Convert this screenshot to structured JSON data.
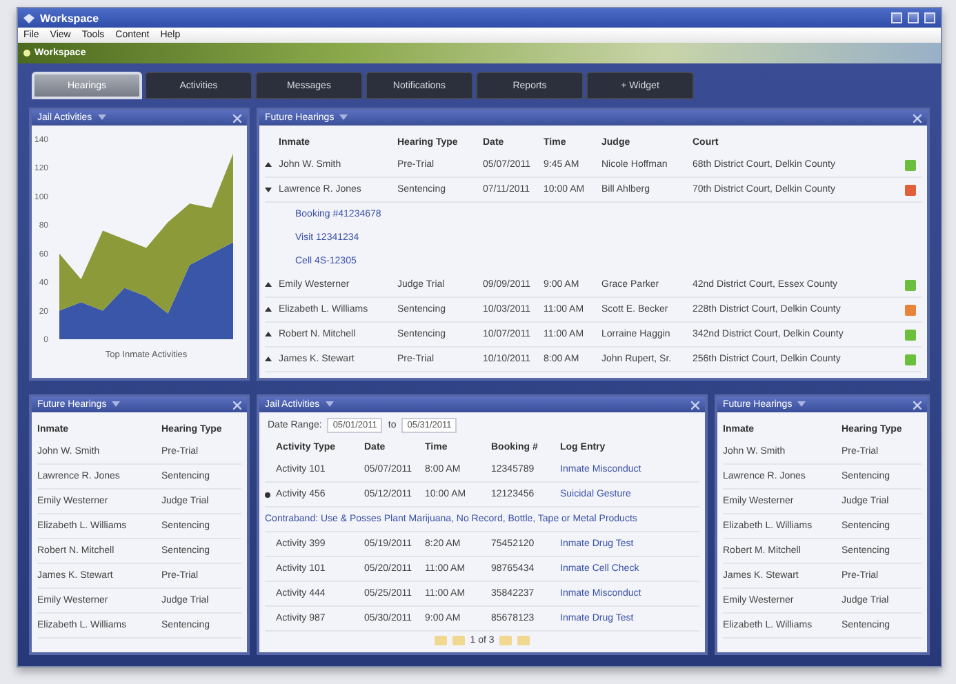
{
  "window": {
    "title": "Workspace"
  },
  "menu": [
    "File",
    "View",
    "Tools",
    "Content",
    "Help"
  ],
  "workspace_label": "Workspace",
  "tabs": [
    {
      "label": "Hearings",
      "selected": true
    },
    {
      "label": "Activities",
      "selected": false
    },
    {
      "label": "Messages",
      "selected": false
    },
    {
      "label": "Notifications",
      "selected": false
    },
    {
      "label": "Reports",
      "selected": false
    },
    {
      "label": "+ Widget",
      "selected": false
    }
  ],
  "jail_chart": {
    "title": "Jail Activities",
    "chart_data": {
      "type": "area",
      "stacked": true,
      "xlabel": "Top Inmate Activities",
      "ylim": [
        0,
        140
      ],
      "yticks": [
        0,
        20,
        40,
        60,
        80,
        100,
        120,
        140
      ],
      "series": [
        {
          "color": "#3a56a8",
          "values": [
            20,
            26,
            20,
            36,
            30,
            18,
            52,
            60,
            68
          ]
        },
        {
          "color": "#8c9a3a",
          "values": [
            40,
            16,
            56,
            34,
            34,
            64,
            43,
            32,
            62
          ]
        }
      ]
    }
  },
  "future_hearings": {
    "title": "Future Hearings",
    "columns": [
      "Inmate",
      "Hearing Type",
      "Date",
      "Time",
      "Judge",
      "Court"
    ],
    "rows": [
      {
        "cells": [
          "John W. Smith",
          "Pre-Trial",
          "05/07/2011",
          "9:45 AM",
          "Nicole Hoffman",
          "68th District Court, Delkin County"
        ],
        "expanded": false,
        "color": "#6cbf3c"
      },
      {
        "cells": [
          "Lawrence R. Jones",
          "Sentencing",
          "07/11/2011",
          "10:00 AM",
          "Bill Ahlberg",
          "70th District Court, Delkin County"
        ],
        "expanded": true,
        "color": "#e0603a",
        "details": [
          "Booking #41234678",
          "Visit 12341234",
          "Cell 4S-12305"
        ]
      },
      {
        "cells": [
          "Emily Westerner",
          "Judge Trial",
          "09/09/2011",
          "9:00 AM",
          "Grace Parker",
          "42nd District Court, Essex County"
        ],
        "expanded": false,
        "color": "#6cbf3c"
      },
      {
        "cells": [
          "Elizabeth L. Williams",
          "Sentencing",
          "10/03/2011",
          "11:00 AM",
          "Scott E. Becker",
          "228th District Court, Delkin County"
        ],
        "expanded": false,
        "color": "#e8843a"
      },
      {
        "cells": [
          "Robert N. Mitchell",
          "Sentencing",
          "10/07/2011",
          "11:00 AM",
          "Lorraine Haggin",
          "342nd District Court, Delkin County"
        ],
        "expanded": false,
        "color": "#6cbf3c"
      },
      {
        "cells": [
          "James K. Stewart",
          "Pre-Trial",
          "10/10/2011",
          "8:00 AM",
          "John Rupert, Sr.",
          "256th District Court, Delkin County"
        ],
        "expanded": false,
        "color": "#6cbf3c"
      }
    ]
  },
  "future_hearings_left": {
    "title": "Future Hearings",
    "columns": [
      "Inmate",
      "Hearing Type"
    ],
    "rows": [
      [
        "John W. Smith",
        "Pre-Trial"
      ],
      [
        "Lawrence R. Jones",
        "Sentencing"
      ],
      [
        "Emily Westerner",
        "Judge Trial"
      ],
      [
        "Elizabeth L. Williams",
        "Sentencing"
      ],
      [
        "Robert N. Mitchell",
        "Sentencing"
      ],
      [
        "James K. Stewart",
        "Pre-Trial"
      ],
      [
        "Emily Westerner",
        "Judge Trial"
      ],
      [
        "Elizabeth L. Williams",
        "Sentencing"
      ]
    ]
  },
  "jail_activities": {
    "title": "Jail Activities",
    "date_range": {
      "label": "Date Range:",
      "from": "05/01/2011",
      "separator": "to",
      "to": "05/31/2011"
    },
    "columns": [
      "Activity Type",
      "Date",
      "Time",
      "Booking #",
      "Log Entry"
    ],
    "rows": [
      {
        "cells": [
          "Activity 101",
          "05/07/2011",
          "8:00 AM",
          "12345789",
          "Inmate Misconduct"
        ],
        "expanded": false
      },
      {
        "cells": [
          "Activity 456",
          "05/12/2011",
          "10:00 AM",
          "12123456",
          "Suicidal Gesture"
        ],
        "expanded": true,
        "detail": "Contraband: Use & Posses Plant Marijuana, No Record, Bottle, Tape or Metal Products"
      },
      {
        "cells": [
          "Activity 399",
          "05/19/2011",
          "8:20 AM",
          "75452120",
          "Inmate Drug Test"
        ],
        "expanded": false
      },
      {
        "cells": [
          "Activity 101",
          "05/20/2011",
          "11:00 AM",
          "98765434",
          "Inmate Cell Check"
        ],
        "expanded": false
      },
      {
        "cells": [
          "Activity 444",
          "05/25/2011",
          "11:00 AM",
          "35842237",
          "Inmate Misconduct"
        ],
        "expanded": false
      },
      {
        "cells": [
          "Activity 987",
          "05/30/2011",
          "9:00 AM",
          "85678123",
          "Inmate Drug Test"
        ],
        "expanded": false
      }
    ],
    "pager": "1 of 3"
  },
  "future_hearings_right": {
    "title": "Future Hearings",
    "columns": [
      "Inmate",
      "Hearing Type"
    ],
    "rows": [
      [
        "John W. Smith",
        "Pre-Trial"
      ],
      [
        "Lawrence R. Jones",
        "Sentencing"
      ],
      [
        "Emily Westerner",
        "Judge Trial"
      ],
      [
        "Elizabeth L. Williams",
        "Sentencing"
      ],
      [
        "Robert M. Mitchell",
        "Sentencing"
      ],
      [
        "James K. Stewart",
        "Pre-Trial"
      ],
      [
        "Emily Westerner",
        "Judge Trial"
      ],
      [
        "Elizabeth L. Williams",
        "Sentencing"
      ]
    ]
  }
}
